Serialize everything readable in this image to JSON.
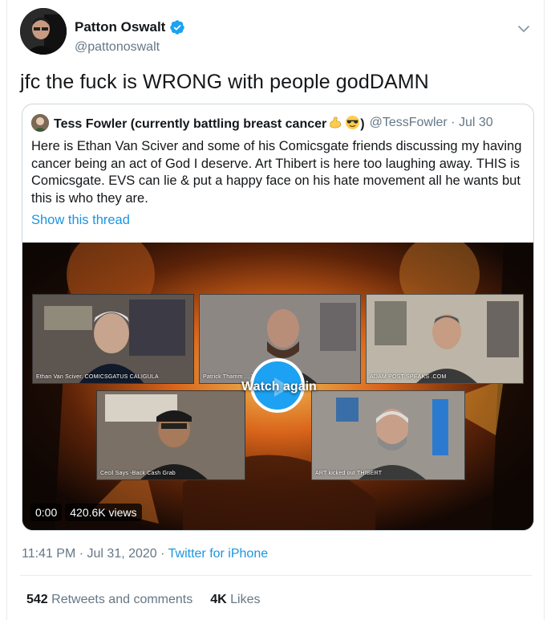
{
  "author": {
    "name": "Patton Oswalt",
    "handle": "@pattonoswalt"
  },
  "tweet": {
    "text": "jfc the fuck is WRONG with people godDAMN",
    "timestamp": "11:41 PM · Jul 31, 2020 · ",
    "source": "Twitter for iPhone"
  },
  "quoted": {
    "name": "Tess Fowler (currently battling breast cancer",
    "name_close": ")",
    "handle": "@TessFowler · Jul 30",
    "text": "Here is Ethan Van Sciver and some of his Comicsgate friends discussing my having cancer being an act of God I deserve. Art Thibert is here too laughing away. THIS is Comicsgate. EVS can lie & put a happy face on his hate movement all he wants but this is who they are.",
    "show_thread": "Show this thread",
    "emojis": [
      "flexed-biceps-emoji",
      "sunglasses-emoji"
    ]
  },
  "video": {
    "watch_again": "Watch again",
    "time": "0:00",
    "views": "420.6K views",
    "panels": [
      "Ethan Van Sciver. COMICSGATUS CALIGULA",
      "Patrick Thamm ... Thantasium",
      "ADAM POST SPEAKS .COM",
      "Cecil Says -Back Cash Grab",
      "ART kicked out THIBERT"
    ]
  },
  "stats": {
    "retweets_count": "542",
    "retweets_label": "Retweets and comments",
    "likes_count": "4K",
    "likes_label": "Likes"
  },
  "colors": {
    "link": "#1b95e0",
    "verified": "#1da1f2",
    "secondary_text": "#657786"
  }
}
